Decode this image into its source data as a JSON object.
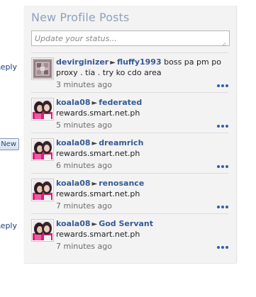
{
  "left_edge": {
    "reply_label_1": "Reply",
    "new_button": "New",
    "reply_label_2": "Reply"
  },
  "panel": {
    "title": "New Profile Posts",
    "status_placeholder": "Update your status..."
  },
  "posts": [
    {
      "author": "devirginizer",
      "target": "fluffy1993",
      "message": "boss pa pm po proxy . tia . try ko cdo area",
      "time": "3 minutes ago",
      "avatar": "pattern-avatar"
    },
    {
      "author": "koala08",
      "target": "federated",
      "message": "rewards.smart.net.ph",
      "time": "5 minutes ago",
      "avatar": "photo-avatar"
    },
    {
      "author": "koala08",
      "target": "dreamrich",
      "message": "rewards.smart.net.ph",
      "time": "6 minutes ago",
      "avatar": "photo-avatar"
    },
    {
      "author": "koala08",
      "target": "renosance",
      "message": "rewards.smart.net.ph",
      "time": "7 minutes ago",
      "avatar": "photo-avatar"
    },
    {
      "author": "koala08",
      "target": "God Servant",
      "message": "rewards.smart.net.ph",
      "time": "7 minutes ago",
      "avatar": "photo-avatar"
    }
  ],
  "colors": {
    "link": "#355a96",
    "more": "#2f5faa",
    "panel_bg": "#f3f3f3",
    "title": "#8ea1bd"
  }
}
